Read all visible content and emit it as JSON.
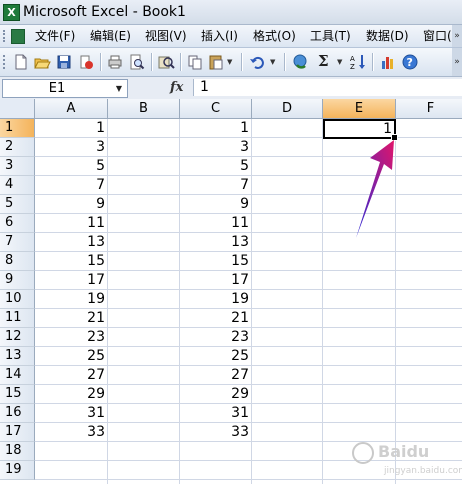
{
  "window": {
    "title": "Microsoft Excel - Book1"
  },
  "menu": {
    "items": [
      "文件(F)",
      "编辑(E)",
      "视图(V)",
      "插入(I)",
      "格式(O)",
      "工具(T)",
      "数据(D)",
      "窗口("
    ]
  },
  "toolbar": {
    "icons": [
      "new-icon",
      "open-icon",
      "save-icon",
      "permission-icon",
      "print-icon",
      "print-preview-icon",
      "research-icon",
      "copy-icon",
      "paste-icon",
      "undo-icon",
      "hyperlink-icon",
      "autosum-icon",
      "sort-ascending-icon",
      "chart-wizard-icon",
      "help-icon"
    ],
    "sigma": "Σ"
  },
  "formula_bar": {
    "name_box": "E1",
    "fx_label": "fx",
    "content": "1"
  },
  "sheet": {
    "columns": [
      "A",
      "B",
      "C",
      "D",
      "E",
      "F"
    ],
    "rows": [
      "1",
      "2",
      "3",
      "4",
      "5",
      "6",
      "7",
      "8",
      "9",
      "10",
      "11",
      "12",
      "13",
      "14",
      "15",
      "16",
      "17",
      "18",
      "19"
    ],
    "active_cell": {
      "ref": "E1",
      "value": "1"
    },
    "column_A": [
      "1",
      "3",
      "5",
      "7",
      "9",
      "11",
      "13",
      "15",
      "17",
      "19",
      "21",
      "23",
      "25",
      "27",
      "29",
      "31",
      "33"
    ],
    "column_C": [
      "1",
      "3",
      "5",
      "7",
      "9",
      "11",
      "13",
      "15",
      "17",
      "19",
      "21",
      "23",
      "25",
      "27",
      "29",
      "31",
      "33"
    ]
  },
  "colors": {
    "selection_header": "#f4b35b",
    "arrow": "#e0156a",
    "arrow_tail": "#2a2ad8"
  },
  "watermark": {
    "brand": "Baidu",
    "sub": "jingyan.baidu.com"
  }
}
